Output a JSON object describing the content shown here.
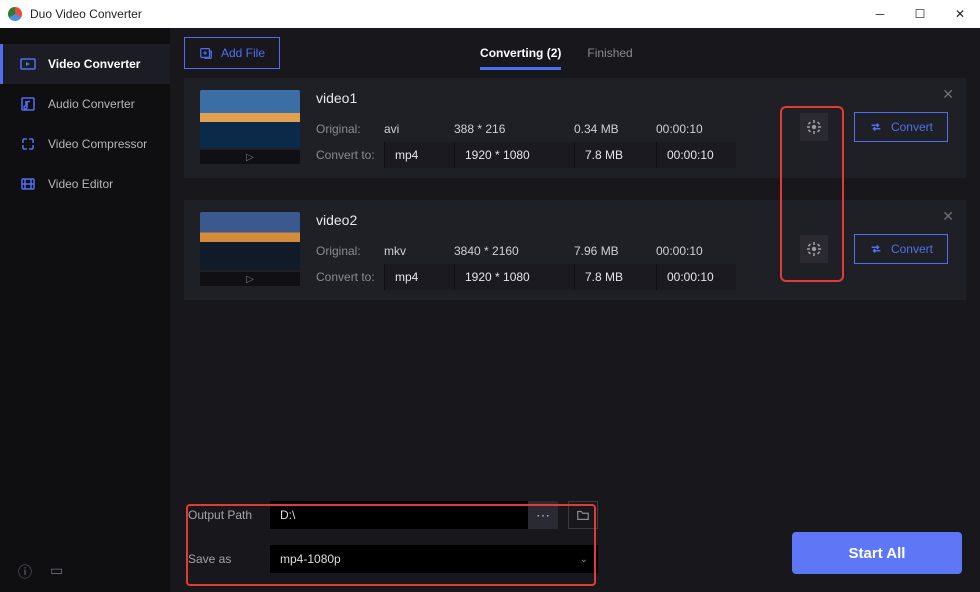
{
  "title": "Duo Video Converter",
  "sidebar": {
    "items": [
      {
        "label": "Video Converter",
        "active": true
      },
      {
        "label": "Audio Converter"
      },
      {
        "label": "Video Compressor"
      },
      {
        "label": "Video Editor"
      }
    ]
  },
  "toolbar": {
    "add_file": "Add File"
  },
  "tabs": {
    "converting": "Converting (2)",
    "finished": "Finished"
  },
  "items": [
    {
      "name": "video1",
      "original_label": "Original:",
      "convert_label": "Convert to:",
      "orig_format": "avi",
      "orig_res": "388 * 216",
      "orig_size": "0.34 MB",
      "orig_dur": "00:00:10",
      "conv_format": "mp4",
      "conv_res": "1920 * 1080",
      "conv_size": "7.8 MB",
      "conv_dur": "00:00:10",
      "convert_btn": "Convert"
    },
    {
      "name": "video2",
      "original_label": "Original:",
      "convert_label": "Convert to:",
      "orig_format": "mkv",
      "orig_res": "3840 * 2160",
      "orig_size": "7.96 MB",
      "orig_dur": "00:00:10",
      "conv_format": "mp4",
      "conv_res": "1920 * 1080",
      "conv_size": "7.8 MB",
      "conv_dur": "00:00:10",
      "convert_btn": "Convert"
    }
  ],
  "footer": {
    "output_path_label": "Output Path",
    "output_path": "D:\\",
    "save_as_label": "Save as",
    "save_as_value": "mp4-1080p",
    "start_all": "Start All"
  }
}
